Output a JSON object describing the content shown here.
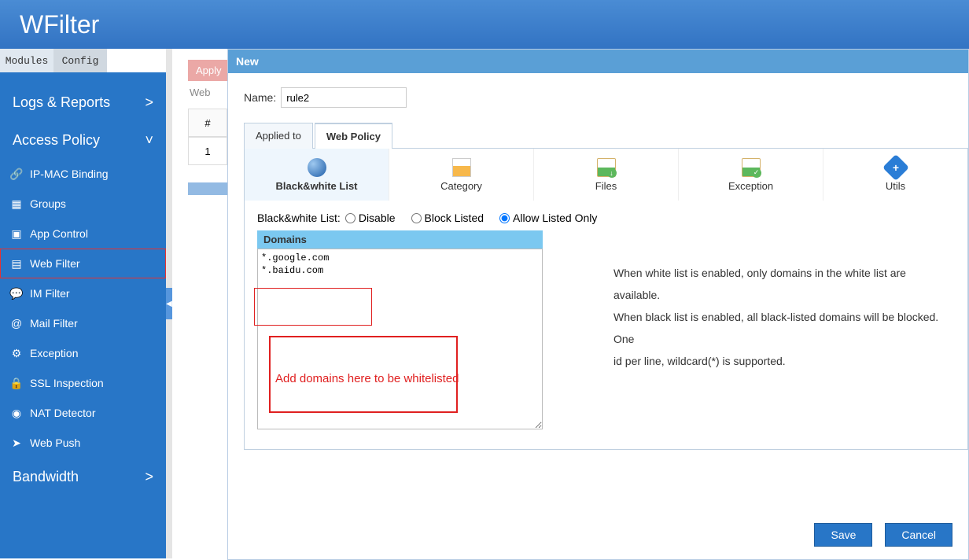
{
  "header": {
    "title": "WFilter"
  },
  "sidebar": {
    "tabs": {
      "modules": "Modules",
      "config": "Config"
    },
    "sections": {
      "logs": {
        "label": "Logs & Reports",
        "chev": ">"
      },
      "access": {
        "label": "Access Policy",
        "chev": "˅"
      },
      "bandwidth": {
        "label": "Bandwidth",
        "chev": ">"
      }
    },
    "items": {
      "ipmac": "IP-MAC Binding",
      "groups": "Groups",
      "appcontrol": "App Control",
      "webfilter": "Web Filter",
      "imfilter": "IM Filter",
      "mailfilter": "Mail Filter",
      "exception": "Exception",
      "sslinspection": "SSL Inspection",
      "natdetector": "NAT Detector",
      "webpush": "Web Push"
    }
  },
  "background": {
    "apply": "Apply",
    "web": "Web",
    "hash": "#",
    "row1": "1"
  },
  "modal": {
    "title": "New",
    "name_label": "Name:",
    "name_value": "rule2",
    "tabs": {
      "applied": "Applied to",
      "webpolicy": "Web Policy"
    },
    "toolbar": {
      "blackwhite": "Black&white List",
      "category": "Category",
      "files": "Files",
      "exception": "Exception",
      "utils": "Utils"
    },
    "bw": {
      "label": "Black&white List:",
      "disable": "Disable",
      "blocklisted": "Block Listed",
      "allowlisted": "Allow Listed Only"
    },
    "domains": {
      "header": "Domains",
      "value": "*.google.com\n*.baidu.com"
    },
    "annotation": "Add domains here to be whitelisted",
    "help": {
      "line1": "When white list is enabled, only domains in the white list are available.",
      "line2": "When black list is enabled, all black-listed domains will be blocked. One",
      "line3": "id per line, wildcard(*) is supported."
    },
    "footer": {
      "save": "Save",
      "cancel": "Cancel"
    }
  }
}
